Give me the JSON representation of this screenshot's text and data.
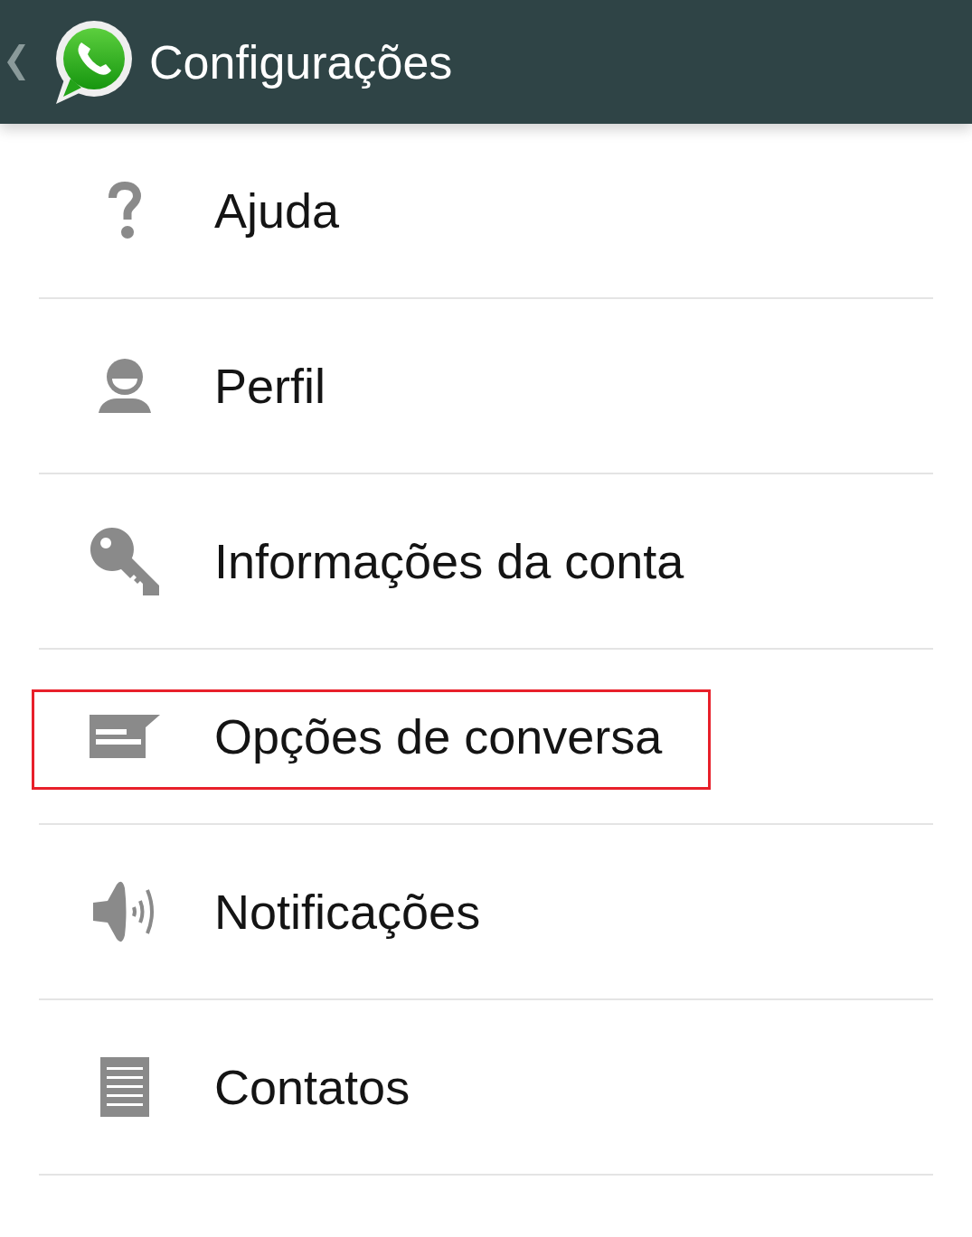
{
  "header": {
    "title": "Configurações"
  },
  "items": [
    {
      "label": "Ajuda",
      "highlighted": false
    },
    {
      "label": "Perfil",
      "highlighted": false
    },
    {
      "label": "Informações da conta",
      "highlighted": false
    },
    {
      "label": "Opções de conversa",
      "highlighted": true
    },
    {
      "label": "Notificações",
      "highlighted": false
    },
    {
      "label": "Contatos",
      "highlighted": false
    }
  ]
}
